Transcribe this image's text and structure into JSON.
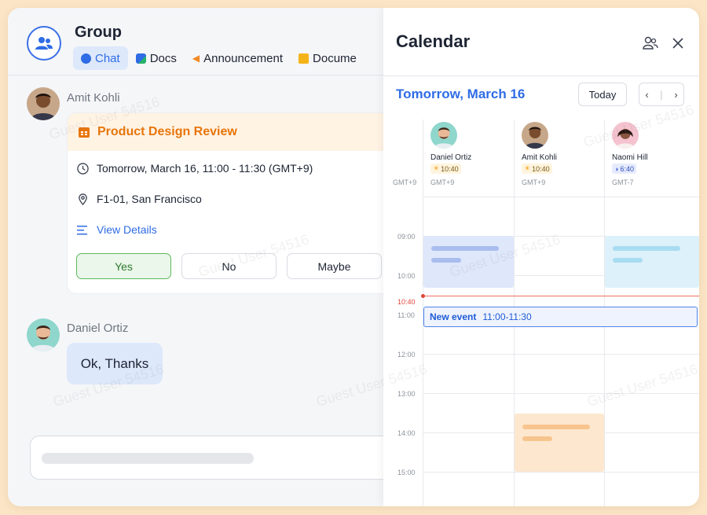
{
  "chat": {
    "group_title": "Group",
    "tabs": [
      {
        "label": "Chat",
        "icon": "chat-bubble-icon",
        "color": "#2f6ce5",
        "active": true
      },
      {
        "label": "Docs",
        "icon": "docs-icon",
        "color": "#2f6ce5",
        "active": false
      },
      {
        "label": "Announcement",
        "icon": "megaphone-icon",
        "color": "#f08a24",
        "active": false
      },
      {
        "label": "Docume",
        "icon": "folder-icon",
        "color": "#f5b31a",
        "active": false
      }
    ],
    "messages": [
      {
        "sender": "Amit Kohli",
        "event": {
          "title": "Product Design Review",
          "time": "Tomorrow, March 16, 11:00 - 11:30 (GMT+9)",
          "location": "F1-01, San Francisco",
          "details_link": "View Details",
          "rsvp": {
            "yes": "Yes",
            "no": "No",
            "maybe": "Maybe",
            "selected": "Yes"
          }
        }
      },
      {
        "sender": "Daniel Ortiz",
        "text": "Ok, Thanks"
      }
    ],
    "composer_placeholder": ""
  },
  "calendar": {
    "title": "Calendar",
    "date_label": "Tomorrow, March 16",
    "today_button": "Today",
    "prev": "‹",
    "next": "›",
    "gutter_tz": "GMT+9",
    "people": [
      {
        "name": "Daniel Ortiz",
        "local_time": "10:40",
        "time_icon": "sun-icon",
        "tz": "GMT+9"
      },
      {
        "name": "Amit Kohli",
        "local_time": "10:40",
        "time_icon": "sun-icon",
        "tz": "GMT+9"
      },
      {
        "name": "Naomi Hill",
        "local_time": "6:40",
        "time_icon": "moon-icon",
        "tz": "GMT-7"
      }
    ],
    "hours": [
      "09:00",
      "10:00",
      "11:00",
      "12:00",
      "13:00",
      "14:00",
      "15:00"
    ],
    "now_label": "10:40",
    "new_event": {
      "label": "New event",
      "time": "11:00-11:30"
    }
  },
  "watermark": "Guest User 54516",
  "colors": {
    "accent": "#2f6ce5",
    "event_orange": "#e8750a",
    "now_line": "#e0453a",
    "background": "#fbe5c6"
  }
}
